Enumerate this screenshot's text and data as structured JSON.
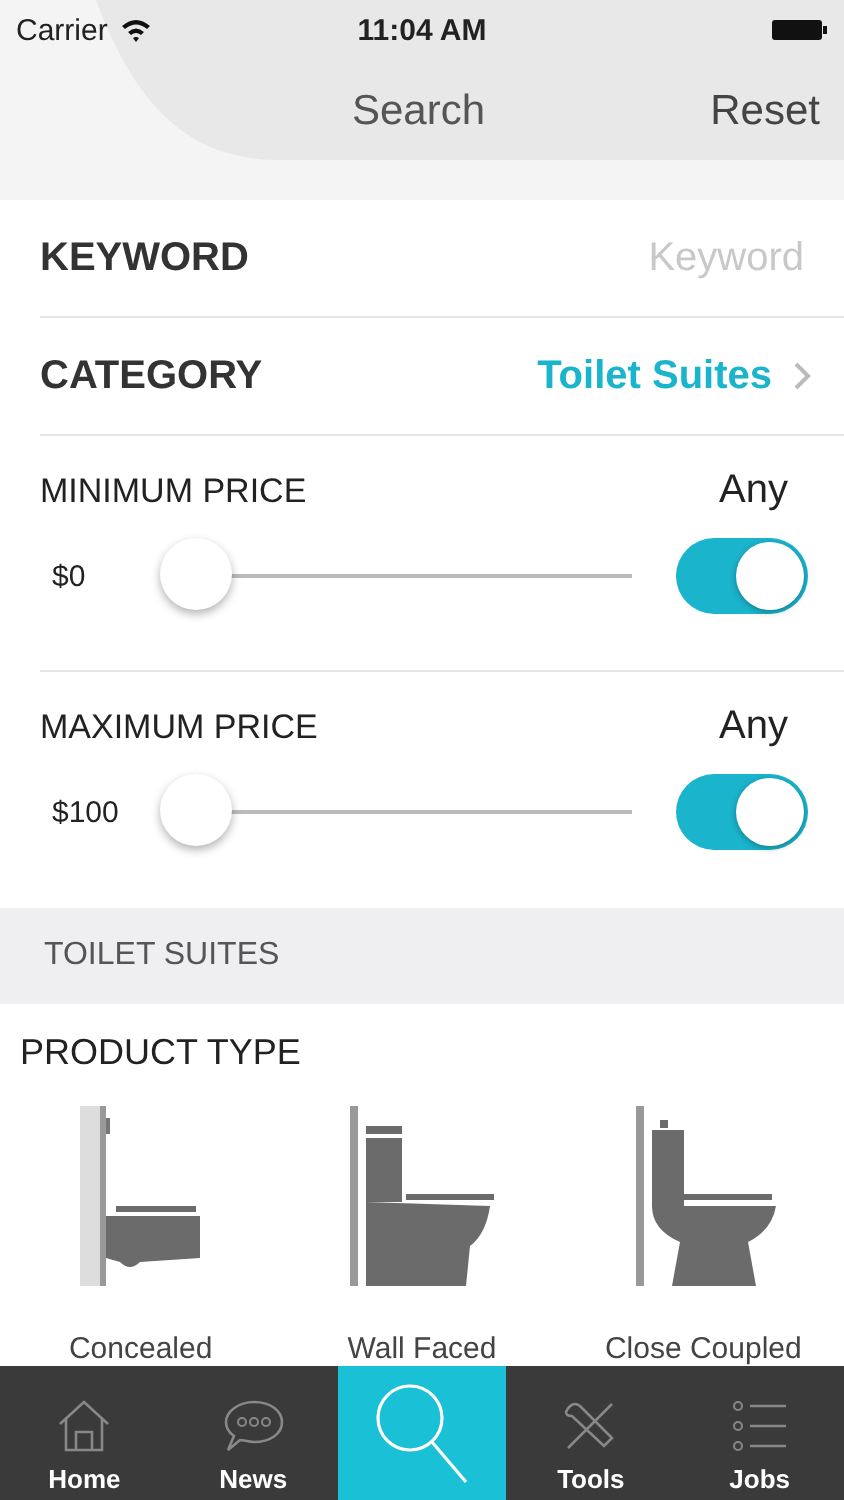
{
  "status_bar": {
    "carrier": "Carrier",
    "time": "11:04 AM"
  },
  "nav": {
    "title": "Search",
    "action": "Reset"
  },
  "keyword": {
    "label": "KEYWORD",
    "placeholder": "Keyword"
  },
  "category": {
    "label": "CATEGORY",
    "value": "Toilet Suites"
  },
  "price_filters": [
    {
      "label": "MINIMUM PRICE",
      "reading": "Any",
      "min_label": "$0",
      "level": 0,
      "on": true
    },
    {
      "label": "MAXIMUM PRICE",
      "reading": "Any",
      "min_label": "$100",
      "level": 0,
      "on": true
    }
  ],
  "section_header": "TOILET SUITES",
  "product_type": {
    "title": "PRODUCT TYPE",
    "items": [
      {
        "kind": "concealed",
        "label": "Concealed"
      },
      {
        "kind": "wall_faced",
        "label": "Wall Faced"
      },
      {
        "kind": "close_coupled",
        "label": "Close Coupled"
      }
    ]
  },
  "tab_bar": [
    {
      "kind": "home",
      "label": "Home",
      "selected": false
    },
    {
      "kind": "news",
      "label": "News",
      "selected": false
    },
    {
      "kind": "search",
      "selected": true
    },
    {
      "kind": "tools",
      "label": "Tools",
      "selected": false
    },
    {
      "kind": "jobs",
      "label": "Jobs",
      "selected": false
    }
  ]
}
